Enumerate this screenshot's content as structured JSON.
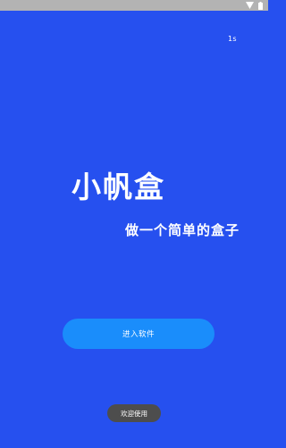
{
  "status_bar": {
    "icons": [
      "wifi-icon",
      "battery-icon"
    ],
    "color": "#b3b3b3"
  },
  "splash": {
    "countdown": "1s",
    "app_title": "小帆盒",
    "app_slogan": "做一个简单的盒子",
    "enter_button_label": "进入软件",
    "welcome_toast": "欢迎使用"
  },
  "colors": {
    "background": "#2650ef",
    "button": "#1a8dfb",
    "toast": "#4d4d4d",
    "text": "#ffffff"
  }
}
